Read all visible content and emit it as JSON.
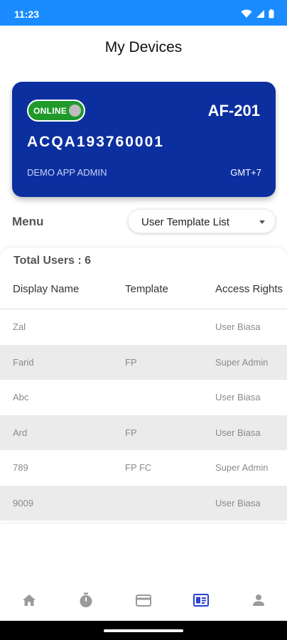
{
  "status_bar": {
    "time": "11:23"
  },
  "header": {
    "title": "My Devices"
  },
  "device": {
    "status": "ONLINE",
    "model": "AF-201",
    "serial": "ACQA193760001",
    "owner": "DEMO APP ADMIN",
    "timezone": "GMT+7"
  },
  "menu": {
    "label": "Menu",
    "selected": "User Template List"
  },
  "users": {
    "total_label": "Total Users : 6",
    "columns": [
      "Display Name",
      "Template",
      "Access Rights"
    ],
    "rows": [
      {
        "name": "Zal",
        "template": "",
        "rights": "User Biasa"
      },
      {
        "name": "Farid",
        "template": "FP",
        "rights": "Super Admin"
      },
      {
        "name": "Abc",
        "template": "",
        "rights": "User Biasa"
      },
      {
        "name": "Ard",
        "template": "FP",
        "rights": "User Biasa"
      },
      {
        "name": "789",
        "template": "FP FC",
        "rights": "Super Admin"
      },
      {
        "name": "9009",
        "template": "",
        "rights": "User Biasa"
      }
    ]
  },
  "bottom_nav": {
    "items": [
      {
        "icon": "home-icon",
        "active": false
      },
      {
        "icon": "timer-icon",
        "active": false
      },
      {
        "icon": "card-icon",
        "active": false
      },
      {
        "icon": "id-card-icon",
        "active": true
      },
      {
        "icon": "person-icon",
        "active": false
      }
    ]
  },
  "colors": {
    "status_bar": "#1a8cff",
    "card": "#0c2fa0",
    "online": "#1f9a2a",
    "nav_active": "#2a3fd8",
    "nav_inactive": "#9a9a9a"
  }
}
